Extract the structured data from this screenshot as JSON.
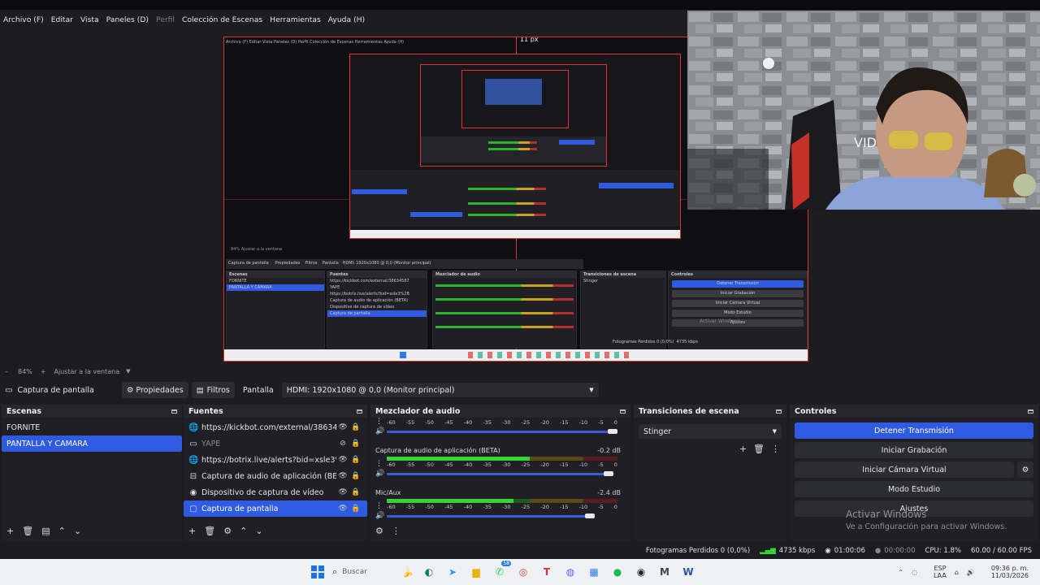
{
  "menu": {
    "items": [
      "Archivo (F)",
      "Editar",
      "Vista",
      "Paneles (D)",
      "Perfil",
      "Colección de Escenas",
      "Herramientas",
      "Ayuda (H)"
    ],
    "disabled_index": 4
  },
  "preview": {
    "px_label": "11 px",
    "mini_menu": "Archivo (F)  Editar  Vista  Paneles (D)  Perfil  Colección de Escenas  Herramientas  Ayuda (H)",
    "mini_docks": {
      "source": "Captura de pantalla",
      "props": "Propiedades",
      "filters": "Filtros",
      "display": "Pantalla",
      "monitor": "HDMI: 1920x1080 @ 0,0 (Monitor principal)",
      "scenes_title": "Escenas",
      "sources_title": "Fuentes",
      "mixer_title": "Mezclador de audio",
      "trans_title": "Transiciones de escena",
      "controls_title": "Controles",
      "zoom": "84%   Ajustar a la ventana",
      "transition": "Stinger",
      "stop": "Detener Transmisión",
      "record": "Iniciar Grabación",
      "vcam": "Iniciar Cámara Virtual",
      "studio": "Modo Estudio",
      "settings": "Ajustes",
      "frames": "Fotogramas Perdidos 0 (0,0%)",
      "kbps": "4735 kbps",
      "watermark": "Activar Windows"
    }
  },
  "zoom": {
    "percent": "84%",
    "plus": "+",
    "fit": "Ajustar a la ventana"
  },
  "source_toolbar": {
    "source_name": "Captura de pantalla",
    "properties": "Propiedades",
    "filters": "Filtros",
    "display_label": "Pantalla",
    "monitor_value": "HDMI: 1920x1080 @ 0,0 (Monitor principal)"
  },
  "scenes": {
    "title": "Escenas",
    "items": [
      "FORNITE",
      "PANTALLA Y CÁMARA"
    ],
    "selected_index": 1
  },
  "sources": {
    "title": "Fuentes",
    "items": [
      {
        "icon": "browser-icon",
        "glyph": "🌐",
        "label": "https://kickbot.com/external/38634587",
        "visible": true
      },
      {
        "icon": "image-icon",
        "glyph": "▭",
        "label": "YAPE",
        "visible": false
      },
      {
        "icon": "browser-icon",
        "glyph": "🌐",
        "label": "https://botrix.live/alerts?bid=xsle3%2B",
        "visible": true
      },
      {
        "icon": "audio-capture-icon",
        "glyph": "⊟",
        "label": "Captura de audio de aplicación (BETA)",
        "visible": true
      },
      {
        "icon": "camera-icon",
        "glyph": "◉",
        "label": "Dispositivo de captura de vídeo",
        "visible": true
      },
      {
        "icon": "monitor-icon",
        "glyph": "▢",
        "label": "Captura de pantalla",
        "visible": true
      }
    ],
    "selected_index": 5
  },
  "mixer": {
    "title": "Mezclador de audio",
    "scale": [
      "-60",
      "-55",
      "-50",
      "-45",
      "-40",
      "-35",
      "-30",
      "-25",
      "-20",
      "-15",
      "-10",
      "-5",
      "0"
    ],
    "channels": [
      {
        "name": "",
        "db": "",
        "level": 0,
        "fader": 0.98
      },
      {
        "name": "Captura de audio de aplicación (BETA)",
        "db": "-0.2 dB",
        "level": 0.62,
        "fader": 0.96
      },
      {
        "name": "Mic/Aux",
        "db": "-2.4 dB",
        "level": 0.55,
        "fader": 0.88
      }
    ]
  },
  "transitions": {
    "title": "Transiciones de escena",
    "selected": "Stinger"
  },
  "controls": {
    "title": "Controles",
    "stop_stream": "Detener Transmisión",
    "start_record": "Iniciar Grabación",
    "start_vcam": "Iniciar Cámara Virtual",
    "studio_mode": "Modo Estudio",
    "settings": "Ajustes"
  },
  "watermark": {
    "title": "Activar Windows",
    "subtitle": "Ve a Configuración para activar Windows."
  },
  "status": {
    "dropped_frames": "Fotogramas Perdidos 0 (0,0%)",
    "bitrate": "4735 kbps",
    "live_time": "01:00:06",
    "rec_time": "00:00:00",
    "cpu": "CPU: 1.8%",
    "fps": "60.00 / 60.00 FPS"
  },
  "taskbar": {
    "search_placeholder": "Buscar",
    "whatsapp_badge": "58",
    "lang": "ESP",
    "region": "LAA",
    "time": "09:36 p. m.",
    "date": "11/03/2026"
  },
  "colors": {
    "accent": "#2f5be0",
    "live_red": "#e0322f",
    "meter_green": "#33d433"
  }
}
